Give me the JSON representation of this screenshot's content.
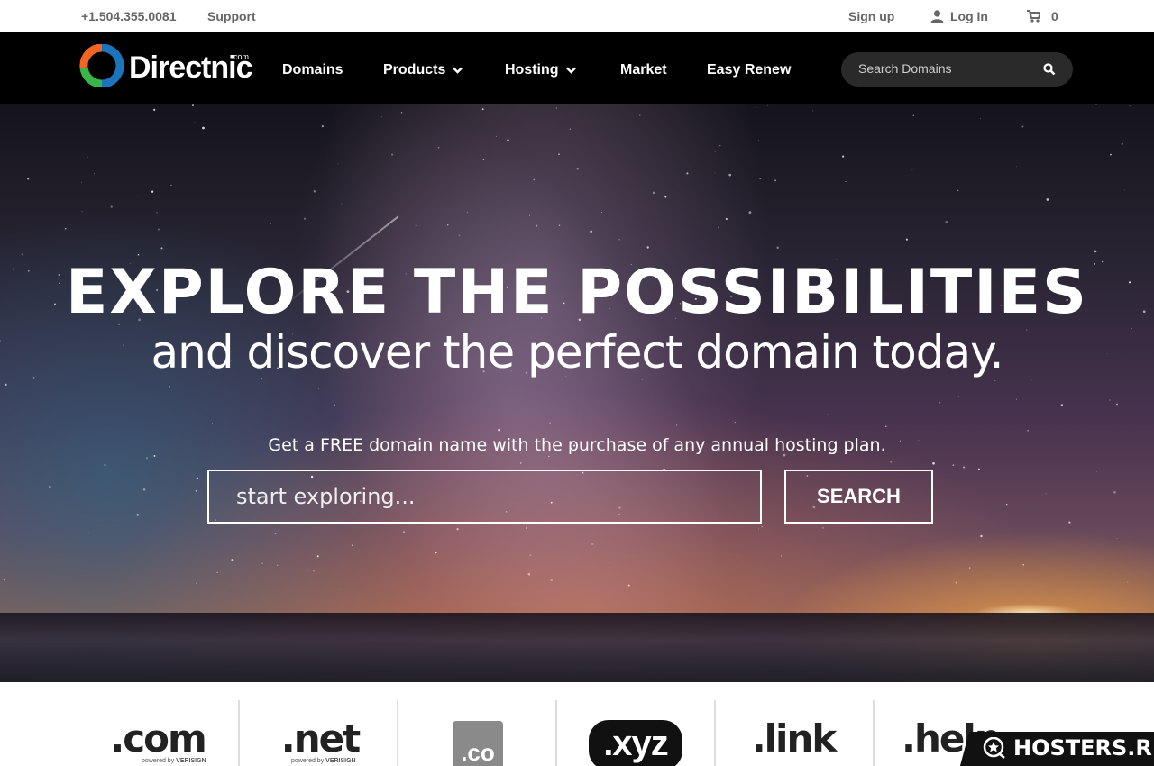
{
  "topbar": {
    "phone": "+1.504.355.0081",
    "support": "Support",
    "signup": "Sign up",
    "login": "Log In",
    "cart_count": "0"
  },
  "nav": {
    "logo_text": "Directnic",
    "logo_sup": "com",
    "items": [
      "Domains",
      "Products",
      "Hosting",
      "Market",
      "Easy Renew"
    ],
    "search_placeholder": "Search Domains"
  },
  "hero": {
    "headline": "EXPLORE THE POSSIBILITIES",
    "subheadline": "and discover the perfect domain today.",
    "promo": "Get a FREE domain name with the purchase of any annual hosting plan.",
    "input_placeholder": "start exploring...",
    "button_label": "SEARCH"
  },
  "tlds": {
    "items": [
      ".com",
      ".net",
      ".co",
      ".xyz",
      ".link",
      ".help"
    ],
    "powered_by": "powered by",
    "verisign": "VERISIGN"
  },
  "badge": {
    "text": "HOSTERS.RU"
  },
  "colors": {
    "nav_bg": "#000000",
    "search_bg": "#2a2a2a",
    "logo_orange": "#f26522",
    "logo_blue": "#1c75bc",
    "logo_green": "#39b54a"
  }
}
